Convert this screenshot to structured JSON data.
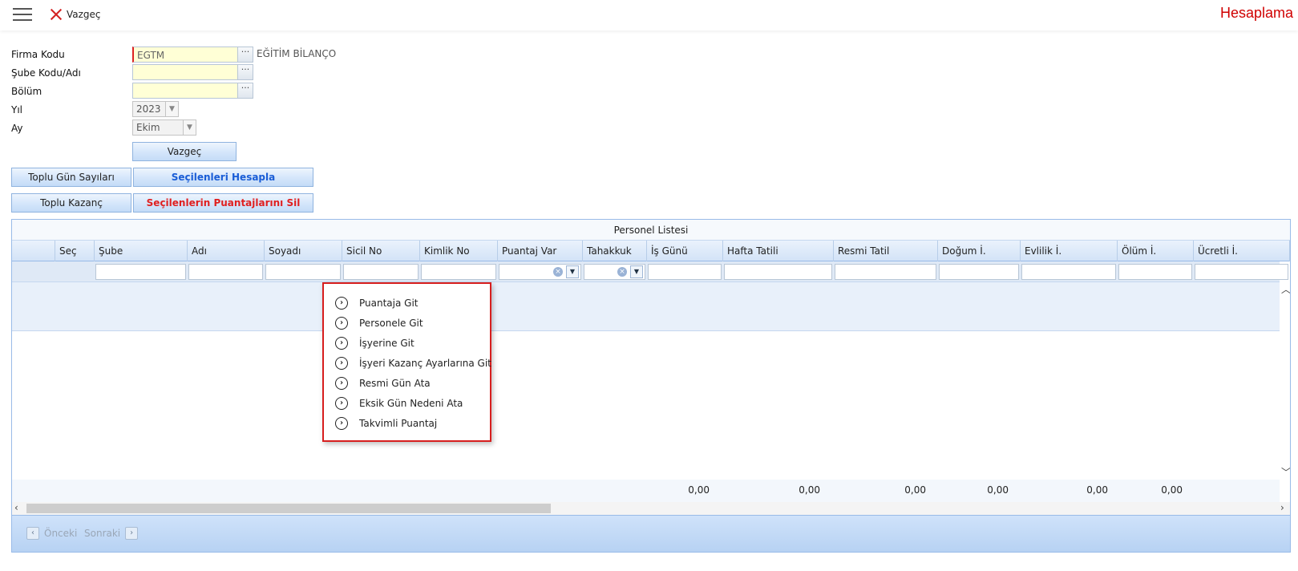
{
  "topbar": {
    "cancel_label": "Vazgeç",
    "title": "Hesaplama"
  },
  "form": {
    "firma_kodu": {
      "label": "Firma Kodu",
      "value": "EGTM",
      "name": "EĞİTİM BİLANÇO"
    },
    "sube": {
      "label": "Şube Kodu/Adı",
      "value": ""
    },
    "bolum": {
      "label": "Bölüm",
      "value": ""
    },
    "yil": {
      "label": "Yıl",
      "value": "2023"
    },
    "ay": {
      "label": "Ay",
      "value": "Ekim"
    }
  },
  "buttons": {
    "cancel": "Vazgeç",
    "toplu_gun": "Toplu Gün Sayıları",
    "hesapla": "Seçilenleri Hesapla",
    "toplu_kazanc": "Toplu Kazanç",
    "sil": "Seçilenlerin Puantajlarını Sil"
  },
  "grid": {
    "caption": "Personel Listesi",
    "columns": [
      "",
      "Seç",
      "Şube",
      "Adı",
      "Soyadı",
      "Sicil No",
      "Kimlik No",
      "Puantaj Var",
      "Tahakkuk",
      "İş Günü",
      "Hafta Tatili",
      "Resmi Tatil",
      "Doğum İ.",
      "Evlilik İ.",
      "Ölüm İ.",
      "Ücretli İ."
    ],
    "summary": [
      "0,00",
      "0,00",
      "0,00",
      "0,00",
      "0,00",
      "0,00"
    ]
  },
  "pager": {
    "prev": "Önceki",
    "next": "Sonraki"
  },
  "context_menu": {
    "items": [
      "Puantaja Git",
      "Personele Git",
      "İşyerine Git",
      "İşyeri Kazanç Ayarlarına Git",
      "Resmi Gün Ata",
      "Eksik Gün Nedeni Ata",
      "Takvimli Puantaj"
    ]
  },
  "colors": {
    "title_red": "#d00000",
    "menu_border": "#d71e1e",
    "accent_blue": "#1a5dd6"
  }
}
